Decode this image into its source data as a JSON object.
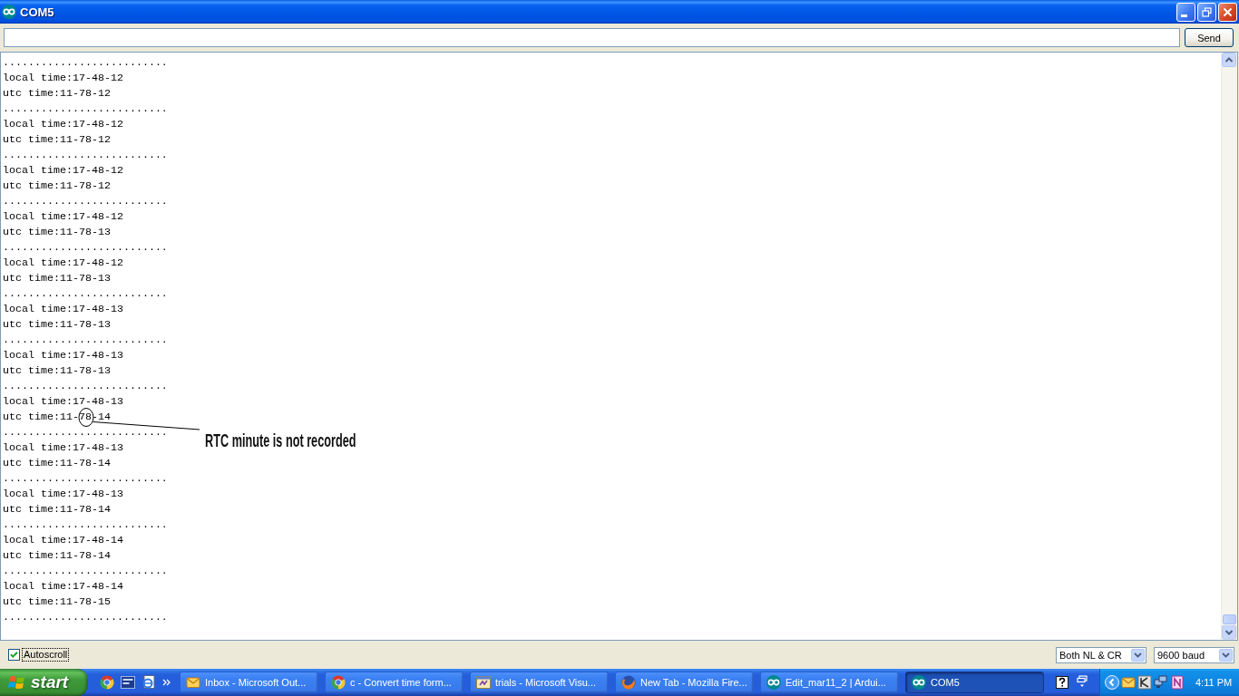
{
  "window": {
    "title": "COM5"
  },
  "send_bar": {
    "button": "Send"
  },
  "serial_output": {
    "lines": [
      {
        "text": "..........................",
        "circled": false
      },
      {
        "text": "local time:17-48-12",
        "circled": false
      },
      {
        "text": "utc time:11-78-12",
        "circled": false
      },
      {
        "text": "..........................",
        "circled": false
      },
      {
        "text": "local time:17-48-12",
        "circled": false
      },
      {
        "text": "utc time:11-78-12",
        "circled": false
      },
      {
        "text": "..........................",
        "circled": false
      },
      {
        "text": "local time:17-48-12",
        "circled": false
      },
      {
        "text": "utc time:11-78-12",
        "circled": false
      },
      {
        "text": "..........................",
        "circled": false
      },
      {
        "text": "local time:17-48-12",
        "circled": false
      },
      {
        "text": "utc time:11-78-13",
        "circled": false
      },
      {
        "text": "..........................",
        "circled": false
      },
      {
        "text": "local time:17-48-12",
        "circled": false
      },
      {
        "text": "utc time:11-78-13",
        "circled": false
      },
      {
        "text": "..........................",
        "circled": false
      },
      {
        "text": "local time:17-48-13",
        "circled": false
      },
      {
        "text": "utc time:11-78-13",
        "circled": false
      },
      {
        "text": "..........................",
        "circled": false
      },
      {
        "text": "local time:17-48-13",
        "circled": false
      },
      {
        "text": "utc time:11-78-13",
        "circled": false
      },
      {
        "text": "..........................",
        "circled": false
      },
      {
        "text": "local time:17-48-13",
        "circled": false
      },
      {
        "text": "utc time:11-78-14",
        "circled": true
      },
      {
        "text": "..........................",
        "circled": false
      },
      {
        "text": "local time:17-48-13",
        "circled": false
      },
      {
        "text": "utc time:11-78-14",
        "circled": false
      },
      {
        "text": "..........................",
        "circled": false
      },
      {
        "text": "local time:17-48-13",
        "circled": false
      },
      {
        "text": "utc time:11-78-14",
        "circled": false
      },
      {
        "text": "..........................",
        "circled": false
      },
      {
        "text": "local time:17-48-14",
        "circled": false
      },
      {
        "text": "utc time:11-78-14",
        "circled": false
      },
      {
        "text": "..........................",
        "circled": false
      },
      {
        "text": "local time:17-48-14",
        "circled": false
      },
      {
        "text": "utc time:11-78-15",
        "circled": false
      },
      {
        "text": "..........................",
        "circled": false
      }
    ],
    "annotation": {
      "text": "RTC minute is not recorded"
    }
  },
  "footer": {
    "autoscroll": {
      "label": "Autoscroll",
      "checked": true,
      "focused": true
    },
    "line_ending": "Both NL & CR",
    "baud_rate": "9600 baud"
  },
  "taskbar": {
    "start_label": "start",
    "tasks": [
      {
        "label": "Inbox - Microsoft Out...",
        "kind": "mail",
        "selected": false
      },
      {
        "label": "c - Convert time form...",
        "kind": "tricolor",
        "selected": false
      },
      {
        "label": "trials - Microsoft Visu...",
        "kind": "window",
        "selected": false
      },
      {
        "label": "New Tab - Mozilla Fire...",
        "kind": "globe",
        "selected": false
      },
      {
        "label": "Edit_mar11_2 | Ardui...",
        "kind": "infinity",
        "selected": false
      },
      {
        "label": "COM5",
        "kind": "infinity",
        "selected": true
      }
    ],
    "clock": "4:11 PM"
  }
}
